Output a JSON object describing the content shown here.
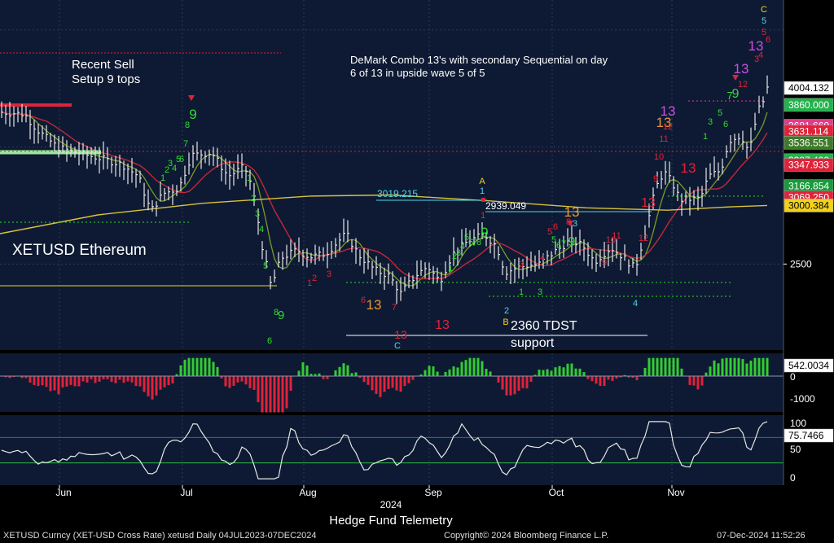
{
  "chart_data": {
    "type": "candlestick",
    "instrument": "XETUSD Ethereum",
    "title": "DeMark Combo 13's with secondary Sequential on day 6 of 13 in upside wave 5 of 5",
    "annotations": {
      "sell_setup": "Recent Sell\nSetup 9 tops",
      "tdst": "2360 TDST\nsupport",
      "level_3019": "3019.215",
      "level_2939": "2939.049"
    },
    "y_range": [
      1800,
      4700
    ],
    "y_ticks": [
      2500
    ],
    "x_labels": [
      "Jun",
      "Jul",
      "Aug",
      "Sep",
      "Oct",
      "Nov"
    ],
    "x_year": "2024",
    "price_tags": [
      {
        "value": "4004.132",
        "price": 4004,
        "color": "#ffffff",
        "text_color": "#000000"
      },
      {
        "value": "3860.000",
        "price": 3860,
        "color": "#22b24c",
        "text_color": "#ffffff"
      },
      {
        "value": "3681.660",
        "price": 3681,
        "color": "#e33b8a",
        "text_color": "#ffffff"
      },
      {
        "value": "3631.114",
        "price": 3631,
        "color": "#e0233a",
        "text_color": "#ffffff"
      },
      {
        "value": "3536.551",
        "price": 3536,
        "color": "#3f7a2a",
        "text_color": "#ffffff"
      },
      {
        "value": "3387.492",
        "price": 3387,
        "color": "#22b24c",
        "text_color": "#ffffff"
      },
      {
        "value": "3347.933",
        "price": 3347,
        "color": "#e0233a",
        "text_color": "#ffffff"
      },
      {
        "value": "3166.854",
        "price": 3166,
        "color": "#1a9a3c",
        "text_color": "#ffffff"
      },
      {
        "value": "3069.250",
        "price": 3069,
        "color": "#e0233a",
        "text_color": "#ffffff"
      },
      {
        "value": "3000.384",
        "price": 3000,
        "color": "#f2d21b",
        "text_color": "#000000"
      }
    ],
    "indicator1": {
      "type": "histogram",
      "ticks": [
        "0",
        "-1000"
      ],
      "last_value": "542.0034",
      "range": [
        -1400,
        700
      ]
    },
    "indicator2": {
      "type": "line",
      "ticks": [
        "100",
        "50",
        "0"
      ],
      "last_value": "75.7466",
      "upper_band": 70,
      "lower_band": 30,
      "range": [
        0,
        100
      ]
    },
    "td_labels": [
      {
        "t": "9",
        "c": "#2fdc2f",
        "x": 237,
        "y": 146,
        "s": 17
      },
      {
        "t": "8",
        "c": "#2fdc2f",
        "x": 230,
        "y": 157,
        "s": 11
      },
      {
        "t": "9",
        "c": "#2fdc2f",
        "x": 595,
        "y": 291,
        "s": 17
      },
      {
        "t": "9",
        "c": "#2fdc2f",
        "x": 345,
        "y": 392,
        "s": 15
      },
      {
        "t": "8",
        "c": "#2fdc2f",
        "x": 339,
        "y": 387,
        "s": 11
      },
      {
        "t": "9",
        "c": "#2fdc2f",
        "x": 702,
        "y": 302,
        "s": 16
      },
      {
        "t": "9",
        "c": "#2fdc2f",
        "x": 903,
        "y": 120,
        "s": 16
      },
      {
        "t": "13",
        "c": "#e8963a",
        "x": 459,
        "y": 380,
        "s": 17
      },
      {
        "t": "13",
        "c": "#e8963a",
        "x": 702,
        "y": 266,
        "s": 17
      },
      {
        "t": "13",
        "c": "#e8963a",
        "x": 815,
        "y": 156,
        "s": 17
      },
      {
        "t": "13",
        "c": "#c84fe0",
        "x": 820,
        "y": 142,
        "s": 17
      },
      {
        "t": "13",
        "c": "#c84fe0",
        "x": 910,
        "y": 90,
        "s": 17
      },
      {
        "t": "13",
        "c": "#c84fe0",
        "x": 928,
        "y": 62,
        "s": 17
      },
      {
        "t": "13",
        "c": "#e0233a",
        "x": 845,
        "y": 212,
        "s": 17
      },
      {
        "t": "13",
        "c": "#e0233a",
        "x": 796,
        "y": 254,
        "s": 16
      },
      {
        "t": "13",
        "c": "#e0233a",
        "x": 543,
        "y": 404,
        "s": 16
      },
      {
        "t": "13",
        "c": "#e0233a",
        "x": 492,
        "y": 416,
        "s": 14
      },
      {
        "t": "C",
        "c": "#f2d21b",
        "x": 938,
        "y": 15,
        "s": 11
      },
      {
        "t": "5",
        "c": "#4fd6e8",
        "x": 938,
        "y": 29,
        "s": 11
      },
      {
        "t": "5",
        "c": "#e0233a",
        "x": 938,
        "y": 43,
        "s": 11
      },
      {
        "t": "6",
        "c": "#e0233a",
        "x": 943,
        "y": 52,
        "s": 11
      },
      {
        "t": "A",
        "c": "#f2d21b",
        "x": 592,
        "y": 226,
        "s": 11
      },
      {
        "t": "1",
        "c": "#4fd6e8",
        "x": 592,
        "y": 238,
        "s": 11
      },
      {
        "t": "1",
        "c": "#e0233a",
        "x": 593,
        "y": 268,
        "s": 11
      },
      {
        "t": "B",
        "c": "#f2d21b",
        "x": 621,
        "y": 399,
        "s": 11
      },
      {
        "t": "2",
        "c": "#4fd6e8",
        "x": 622,
        "y": 385,
        "s": 11
      },
      {
        "t": "C",
        "c": "#4fd6e8",
        "x": 488,
        "y": 428,
        "s": 11
      },
      {
        "t": "4",
        "c": "#4fd6e8",
        "x": 780,
        "y": 376,
        "s": 11
      },
      {
        "t": "3",
        "c": "#4fd6e8",
        "x": 706,
        "y": 278,
        "s": 11
      },
      {
        "t": "6",
        "c": "#2fdc2f",
        "x": 331,
        "y": 422,
        "s": 11
      },
      {
        "t": "5",
        "c": "#2fdc2f",
        "x": 326,
        "y": 330,
        "s": 11
      },
      {
        "t": "4",
        "c": "#2fdc2f",
        "x": 321,
        "y": 285,
        "s": 11
      },
      {
        "t": "3",
        "c": "#2fdc2f",
        "x": 316,
        "y": 266,
        "s": 11
      },
      {
        "t": "2",
        "c": "#2fdc2f",
        "x": 311,
        "y": 247,
        "s": 11
      },
      {
        "t": "1",
        "c": "#2fdc2f",
        "x": 306,
        "y": 222,
        "s": 11
      },
      {
        "t": "7",
        "c": "#2fdc2f",
        "x": 896,
        "y": 122,
        "s": 13
      },
      {
        "t": "5",
        "c": "#2fdc2f",
        "x": 884,
        "y": 142,
        "s": 11
      },
      {
        "t": "3",
        "c": "#2fdc2f",
        "x": 872,
        "y": 153,
        "s": 11
      },
      {
        "t": "1",
        "c": "#2fdc2f",
        "x": 866,
        "y": 171,
        "s": 11
      },
      {
        "t": "6",
        "c": "#2fdc2f",
        "x": 891,
        "y": 156,
        "s": 11
      },
      {
        "t": "1",
        "c": "#2fdc2f",
        "x": 553,
        "y": 333,
        "s": 11
      },
      {
        "t": "2",
        "c": "#2fdc2f",
        "x": 558,
        "y": 318,
        "s": 11
      },
      {
        "t": "3",
        "c": "#2fdc2f",
        "x": 563,
        "y": 314,
        "s": 11
      },
      {
        "t": "4",
        "c": "#2fdc2f",
        "x": 568,
        "y": 306,
        "s": 11
      },
      {
        "t": "5",
        "c": "#2fdc2f",
        "x": 573,
        "y": 295,
        "s": 11
      },
      {
        "t": "6",
        "c": "#2fdc2f",
        "x": 578,
        "y": 301,
        "s": 11
      },
      {
        "t": "7",
        "c": "#2fdc2f",
        "x": 583,
        "y": 301,
        "s": 11
      },
      {
        "t": "8",
        "c": "#2fdc2f",
        "x": 588,
        "y": 301,
        "s": 11
      },
      {
        "t": "1",
        "c": "#2fdc2f",
        "x": 640,
        "y": 362,
        "s": 11
      },
      {
        "t": "3",
        "c": "#2fdc2f",
        "x": 663,
        "y": 362,
        "s": 11
      },
      {
        "t": "5",
        "c": "#2fdc2f",
        "x": 680,
        "y": 298,
        "s": 11
      },
      {
        "t": "6",
        "c": "#2fdc2f",
        "x": 686,
        "y": 305,
        "s": 11
      },
      {
        "t": "7",
        "c": "#2fdc2f",
        "x": 692,
        "y": 303,
        "s": 11
      },
      {
        "t": "1",
        "c": "#2fdc2f",
        "x": 200,
        "y": 222,
        "s": 11
      },
      {
        "t": "2",
        "c": "#2fdc2f",
        "x": 205,
        "y": 212,
        "s": 11
      },
      {
        "t": "3",
        "c": "#2fdc2f",
        "x": 209,
        "y": 204,
        "s": 11
      },
      {
        "t": "4",
        "c": "#2fdc2f",
        "x": 214,
        "y": 210,
        "s": 11
      },
      {
        "t": "5",
        "c": "#2fdc2f",
        "x": 219,
        "y": 199,
        "s": 11
      },
      {
        "t": "6",
        "c": "#2fdc2f",
        "x": 223,
        "y": 199,
        "s": 11
      },
      {
        "t": "7",
        "c": "#2fdc2f",
        "x": 228,
        "y": 180,
        "s": 11
      },
      {
        "t": "1",
        "c": "#e0233a",
        "x": 380,
        "y": 351,
        "s": 11
      },
      {
        "t": "2",
        "c": "#e0233a",
        "x": 386,
        "y": 345,
        "s": 11
      },
      {
        "t": "3",
        "c": "#e0233a",
        "x": 404,
        "y": 340,
        "s": 11
      },
      {
        "t": "6",
        "c": "#e0233a",
        "x": 446,
        "y": 372,
        "s": 11
      },
      {
        "t": "7",
        "c": "#e0233a",
        "x": 484,
        "y": 381,
        "s": 11
      },
      {
        "t": "3",
        "c": "#e0233a",
        "x": 640,
        "y": 328,
        "s": 11
      },
      {
        "t": "4",
        "c": "#e0233a",
        "x": 666,
        "y": 320,
        "s": 11
      },
      {
        "t": "5",
        "c": "#e0233a",
        "x": 675,
        "y": 288,
        "s": 11
      },
      {
        "t": "6",
        "c": "#e0233a",
        "x": 682,
        "y": 282,
        "s": 11
      },
      {
        "t": "8",
        "c": "#e0233a",
        "x": 698,
        "y": 276,
        "s": 11
      },
      {
        "t": "9",
        "c": "#e0233a",
        "x": 742,
        "y": 326,
        "s": 11
      },
      {
        "t": "10",
        "c": "#e0233a",
        "x": 750,
        "y": 298,
        "s": 11
      },
      {
        "t": "11",
        "c": "#e0233a",
        "x": 757,
        "y": 293,
        "s": 11
      },
      {
        "t": "12",
        "c": "#e0233a",
        "x": 790,
        "y": 296,
        "s": 11
      },
      {
        "t": "9",
        "c": "#e0233a",
        "x": 805,
        "y": 223,
        "s": 11
      },
      {
        "t": "10",
        "c": "#e0233a",
        "x": 809,
        "y": 196,
        "s": 11
      },
      {
        "t": "11",
        "c": "#e0233a",
        "x": 815,
        "y": 174,
        "s": 11
      },
      {
        "t": "12",
        "c": "#e0233a",
        "x": 820,
        "y": 159,
        "s": 11
      },
      {
        "t": "12",
        "c": "#e0233a",
        "x": 912,
        "y": 107,
        "s": 11
      },
      {
        "t": "3",
        "c": "#e0233a",
        "x": 929,
        "y": 76,
        "s": 11
      },
      {
        "t": "4",
        "c": "#e0233a",
        "x": 934,
        "y": 71,
        "s": 11
      }
    ]
  },
  "footer": {
    "watermark": "Hedge Fund Telemetry",
    "left": "XETUSD Curncy (XET-USD Cross Rate) xetusd  Daily 04JUL2023-07DEC2024",
    "center": "Copyright© 2024 Bloomberg Finance L.P.",
    "right": "07-Dec-2024 11:52:26"
  },
  "colors": {
    "panel_bg": "#0e1a33",
    "grid": "#2c3b5a",
    "up_bar": "#e6e6e6",
    "ma_green": "#7a9a2a",
    "ma_red": "#c0283a",
    "ma_yellow": "#d8c23a",
    "hist_up": "#33cc33",
    "hist_down": "#e0233a",
    "osc_line": "#e6e6e6",
    "band_red": "#e0233a",
    "band_green": "#2fbf3f"
  }
}
